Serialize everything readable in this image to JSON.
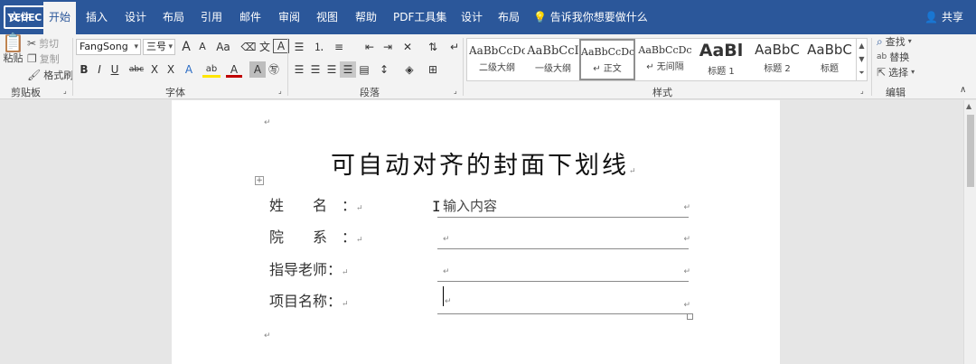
{
  "app": {
    "logo_text": "YEUEC"
  },
  "tabs": [
    {
      "label": "文件"
    },
    {
      "label": "开始"
    },
    {
      "label": "插入"
    },
    {
      "label": "设计"
    },
    {
      "label": "布局"
    },
    {
      "label": "引用"
    },
    {
      "label": "邮件"
    },
    {
      "label": "审阅"
    },
    {
      "label": "视图"
    },
    {
      "label": "帮助"
    },
    {
      "label": "PDF工具集"
    },
    {
      "label": "设计"
    },
    {
      "label": "布局"
    }
  ],
  "tell_me": "告诉我你想要做什么",
  "share": "共享",
  "clipboard": {
    "paste": "粘贴",
    "cut": "剪切",
    "copy": "复制",
    "format_painter": "格式刷",
    "group_label": "剪贴板"
  },
  "font": {
    "family": "FangSong",
    "size": "三号",
    "grow": "A",
    "shrink": "A",
    "change_case": "Aa",
    "wen": "文",
    "A_box": "A",
    "bold": "B",
    "italic": "I",
    "underline": "U",
    "strike": "abc",
    "subscript": "X",
    "superscript": "X",
    "effects": "A",
    "highlight": "ab",
    "font_color": "A",
    "char_shading": "A",
    "group_label": "字体"
  },
  "paragraph": {
    "group_label": "段落"
  },
  "styles": {
    "group_label": "样式",
    "items": [
      {
        "sample": "AaBbCcDc",
        "name": "二级大纲"
      },
      {
        "sample": "AaBbCcI",
        "name": "一级大纲"
      },
      {
        "sample": "AaBbCcDc",
        "name": "↵ 正文"
      },
      {
        "sample": "AaBbCcDc",
        "name": "↵ 无间隔"
      },
      {
        "sample": "AaBl",
        "name": "标题 1"
      },
      {
        "sample": "AaBbC",
        "name": "标题 2"
      },
      {
        "sample": "AaBbC",
        "name": "标题"
      }
    ]
  },
  "editing": {
    "find": "查找",
    "replace": "替换",
    "select": "选择",
    "group_label": "编辑"
  },
  "document": {
    "title": "可自动对齐的封面下划线",
    "para_mark": "↵",
    "rows": [
      {
        "label": "姓　　名　：",
        "value": "输入内容"
      },
      {
        "label": "院　　系　：",
        "value": ""
      },
      {
        "label": "指导老师：",
        "value": ""
      },
      {
        "label": "项目名称：",
        "value": ""
      }
    ]
  },
  "colors": {
    "ribbon_blue": "#2b579a",
    "ribbon_bg": "#f3f3f3",
    "workspace": "#e6e6e6"
  }
}
